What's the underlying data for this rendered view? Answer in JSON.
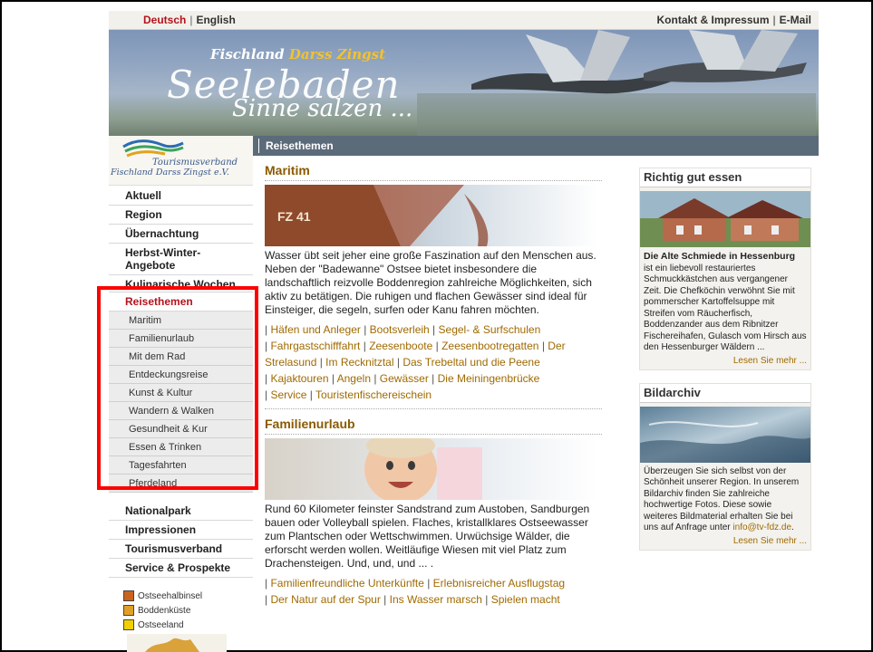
{
  "topbar": {
    "lang_de": "Deutsch",
    "lang_sep": "|",
    "lang_en": "English",
    "link_contact": "Kontakt & Impressum",
    "link_sep": "|",
    "link_email": "E-Mail"
  },
  "header": {
    "brand_a": "Fischland",
    "brand_b": "Darss Zingst",
    "slogan_big": "Seelebaden",
    "slogan_small": "Sinne salzen ..."
  },
  "logo": {
    "line1": "Tourismusverband",
    "line2": "Fischland Darss Zingst e.V."
  },
  "subbar": {
    "label": "Reisethemen"
  },
  "nav": {
    "top": [
      "Aktuell",
      "Region",
      "Übernachtung",
      "Herbst-Winter-Angebote",
      "Kulinarische Wochen"
    ],
    "active": "Reisethemen",
    "sub": [
      "Maritim",
      "Familienurlaub",
      "Mit dem Rad",
      "Entdeckungsreise",
      "Kunst & Kultur",
      "Wandern & Walken",
      "Gesundheit & Kur",
      "Essen & Trinken",
      "Tagesfahrten",
      "Pferdeland"
    ],
    "bottom": [
      "Nationalpark",
      "Impressionen",
      "Tourismusverband",
      "Service & Prospekte"
    ]
  },
  "legend": {
    "items": [
      {
        "label": "Ostseehalbinsel",
        "color": "#c8641e"
      },
      {
        "label": "Boddenküste",
        "color": "#e0a028"
      },
      {
        "label": "Ostseeland",
        "color": "#f0d000"
      }
    ]
  },
  "sections": {
    "maritim": {
      "title": "Maritim",
      "img_label": "FZ 41",
      "text": "Wasser übt seit jeher eine große Faszination auf den Menschen aus. Neben der \"Badewanne\" Ostsee bietet insbesondere die landschaftlich reizvolle Boddenregion zahlreiche Möglichkeiten, sich aktiv zu betätigen. Die ruhigen und flachen Gewässer sind ideal für Einsteiger, die segeln, surfen oder Kanu fahren möchten.",
      "links": [
        "Häfen und Anleger",
        "Bootsverleih",
        "Segel- & Surfschulen",
        "Fahrgastschifffahrt",
        "Zeesenboote",
        "Zeesenbootregatten",
        "Der Strelasund",
        "Im Recknitztal",
        "Das Trebeltal und die Peene",
        "Kajaktouren",
        "Angeln",
        "Gewässer",
        "Die Meiningenbrücke",
        "Service",
        "Touristenfischereischein"
      ]
    },
    "familie": {
      "title": "Familienurlaub",
      "text": "Rund 60 Kilometer feinster Sandstrand zum Austoben, Sandburgen bauen oder Volleyball spielen. Flaches, kristallklares Ostseewasser zum Plantschen oder Wettschwimmen. Urwüchsige Wälder, die erforscht werden wollen. Weitläufige Wiesen mit viel Platz zum Drachensteigen. Und, und, und ... .",
      "links": [
        "Familienfreundliche Unterkünfte",
        "Erlebnisreicher Ausflugstag",
        "Der Natur auf der Spur",
        "Ins Wasser marsch",
        "Spielen macht"
      ]
    }
  },
  "right": {
    "box1": {
      "title": "Richtig gut essen",
      "heading": "Die Alte Schmiede in Hessenburg",
      "text": "ist ein liebevoll restauriertes Schmuckkästchen aus vergangener Zeit. Die Chefköchin verwöhnt Sie mit pommerscher Kartoffelsuppe mit Streifen vom Räucherfisch, Boddenzander aus dem Ribnitzer Fischereihafen, Gulasch vom Hirsch aus den Hessenburger Wäldern ...",
      "more": "Lesen Sie mehr ..."
    },
    "box2": {
      "title": "Bildarchiv",
      "text": "Überzeugen Sie sich selbst von der Schönheit unserer Region. In unserem Bildarchiv finden Sie zahlreiche hochwertige Fotos. Diese sowie weiteres Bildmaterial erhalten Sie bei uns auf Anfrage unter",
      "email": "info@tv-fdz.de",
      "text_end": ".",
      "more": "Lesen Sie mehr ..."
    }
  }
}
